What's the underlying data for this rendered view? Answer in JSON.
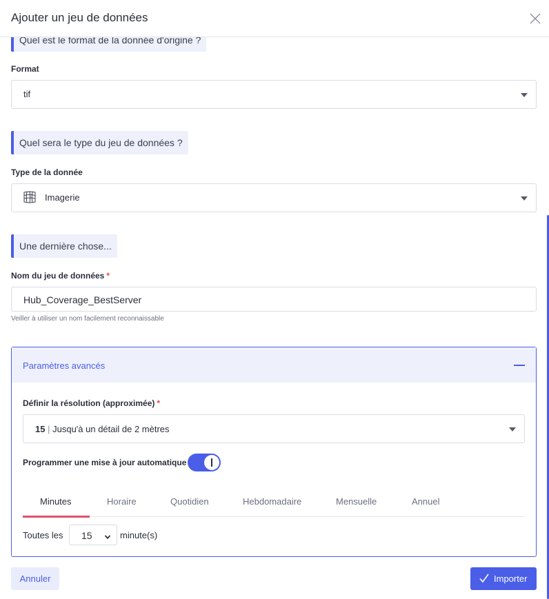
{
  "dialog": {
    "title": "Ajouter un jeu de données",
    "close_icon": "close-icon"
  },
  "source_format": {
    "question": "Quel est le format de la donnée d'origine ?",
    "label": "Format",
    "value": "tif"
  },
  "dataset_type": {
    "question": "Quel sera le type du jeu de données ?",
    "label": "Type de la donnée",
    "icon": "imagery-grid-icon",
    "value": "Imagerie"
  },
  "final": {
    "question": "Une dernière chose...",
    "name_label": "Nom du jeu de données",
    "required_mark": "*",
    "name_value": "Hub_Coverage_BestServer",
    "helper": "Veiller à utiliser un nom facilement reconnaissable"
  },
  "advanced": {
    "title": "Paramètres avancés",
    "resolution_label": "Définir la résolution (approximée)",
    "required_mark": "*",
    "resolution_level": "15",
    "resolution_separator": "|",
    "resolution_desc": "Jusqu'à un détail de 2 mètres",
    "auto_update_label": "Programmer une mise à jour automatique",
    "auto_update_enabled": true,
    "tabs": [
      "Minutes",
      "Horaire",
      "Quotidien",
      "Hebdomadaire",
      "Mensuelle",
      "Annuel"
    ],
    "active_tab": "Minutes",
    "interval_prefix": "Toutes les",
    "interval_value": "15",
    "interval_unit": "minute(s)"
  },
  "footer": {
    "cancel_label": "Annuler",
    "import_label": "Importer"
  },
  "colors": {
    "accent": "#4a5ee8",
    "tab_underline": "#e0506b",
    "required": "#e14c4c"
  }
}
